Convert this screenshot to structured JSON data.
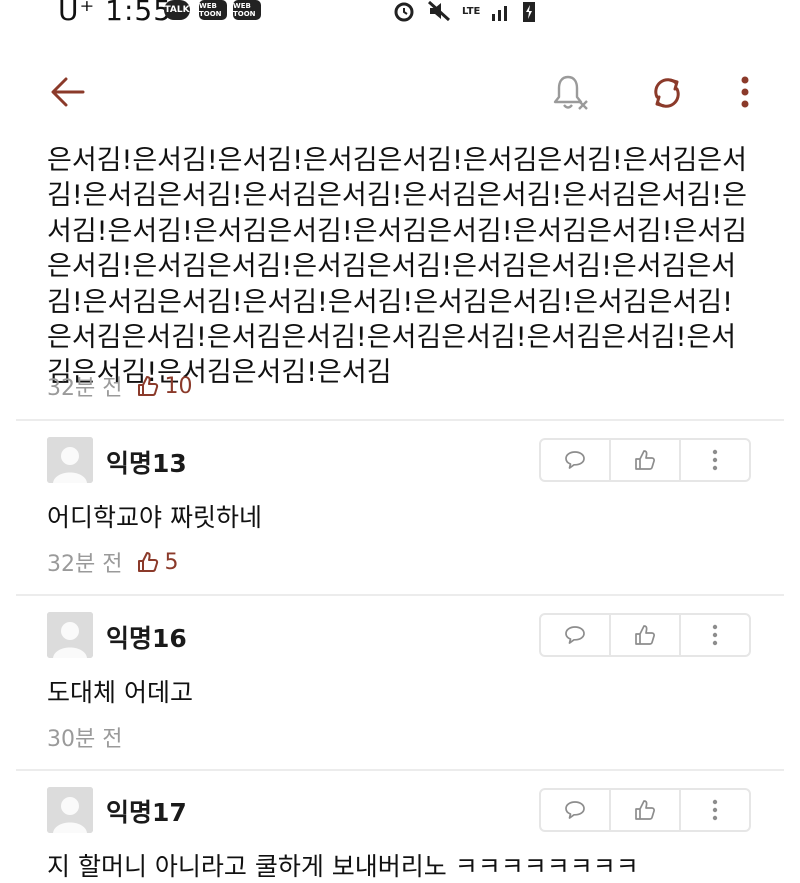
{
  "status_bar": {
    "carrier": "U⁺ 1:55",
    "badges": [
      "TALK",
      "WEB TOON",
      "WEB TOON"
    ],
    "network": "LTE"
  },
  "header": {
    "back": "back",
    "icons": [
      "bell-off-icon",
      "refresh-icon",
      "more-vertical-icon"
    ],
    "accent": "#8b3a2a",
    "muted_icon_color": "#9a9a9a"
  },
  "post": {
    "body": "은서김!은서김!은서김!은서김은서김!은서김은서김!은서김은서김!은서김은서김!은서김은서김!은서김은서김!은서김은서김!은서김!은서김!은서김은서김!은서김은서김!은서김은서김!은서김은서김!은서김은서김!은서김은서김!은서김은서김!은서김은서김!은서김은서김!은서김!은서김!은서김은서김!은서김은서김!은서김은서김!은서김은서김!은서김은서김!은서김은서김!은서김은서김!은서김은서김!은서김",
    "time": "32분 전",
    "likes": "10"
  },
  "comments": [
    {
      "nickname": "익명13",
      "text": "어디학교야 짜릿하네",
      "time": "32분 전",
      "likes": "5"
    },
    {
      "nickname": "익명16",
      "text": "도대체 어데고",
      "time": "30분 전",
      "likes": ""
    },
    {
      "nickname": "익명17",
      "text": "지 할머니 아니라고 쿨하게 보내버리노 ㅋㅋㅋㅋㅋㅋㅋㅋ",
      "time": "",
      "likes": ""
    }
  ]
}
